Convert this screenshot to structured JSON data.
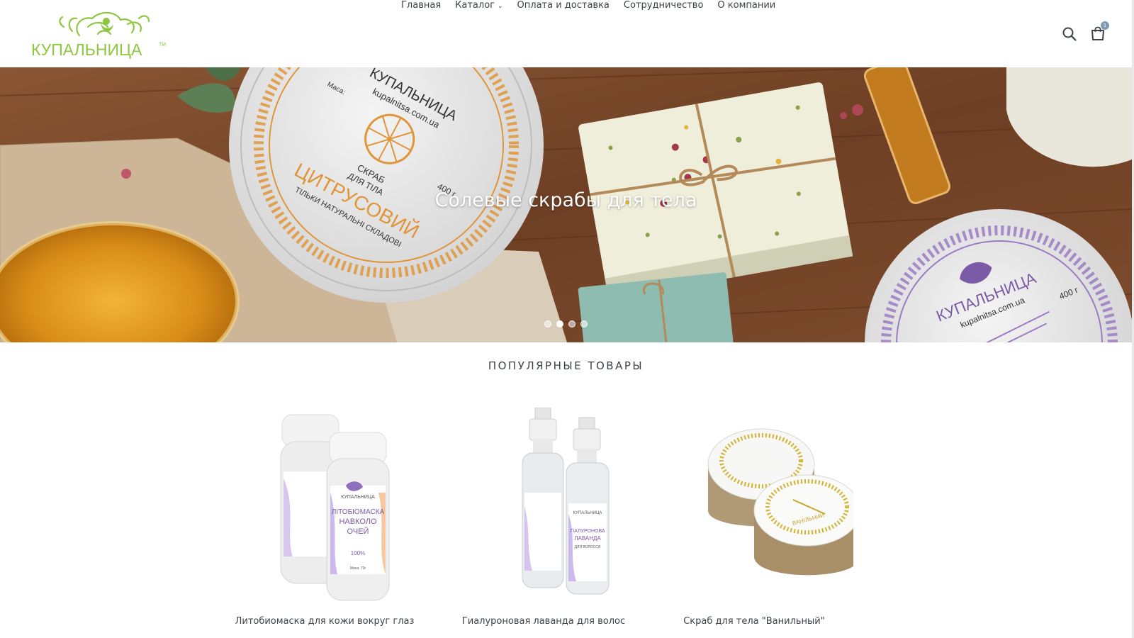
{
  "header": {
    "logo_text": "КУПАЛЬНИЦА",
    "logo_tm": "TM",
    "nav": [
      {
        "label": "Главная"
      },
      {
        "label": "Каталог",
        "has_dropdown": true
      },
      {
        "label": "Оплата и доставка"
      },
      {
        "label": "Сотрудничество"
      },
      {
        "label": "О компании"
      }
    ],
    "cart_count": "1",
    "icons": {
      "search": "search-icon",
      "cart": "cart-icon"
    }
  },
  "hero": {
    "caption": "Солевые скрабы для тела",
    "slides": 4,
    "active_slide": 2,
    "jar1": {
      "brand": "КУПАЛЬНИЦА",
      "site": "kupalnitsa.com.ua",
      "line1": "СКРАБ",
      "line2": "ДЛЯ ТІЛА",
      "name": "ЦИТРУСОВИЙ",
      "tagline": "ТІЛЬКИ НАТУРАЛЬНІ СКЛАДОВІ",
      "weight": "400 г",
      "mass": "Маса:"
    },
    "jar2": {
      "brand": "КУПАЛЬНИЦА",
      "site": "kupalnitsa.com.ua",
      "weight": "400 г"
    }
  },
  "popular": {
    "title": "ПОПУЛЯРНЫЕ ТОВАРЫ",
    "products": [
      {
        "name": "Литобиомаска для кожи вокруг глаз",
        "label_brand": "КУПАЛЬНИЦА",
        "label_title_1": "ЛІТОБІОМАСКА",
        "label_title_2": "НАВКОЛО",
        "label_title_3": "ОЧЕЙ",
        "label_pct": "100%",
        "label_mass": "Маса: 70г"
      },
      {
        "name": "Гиалуроновая лаванда для волос",
        "label_brand": "КУПАЛЬНИЦА",
        "label_title_1": "ГІАЛУРОНОВА",
        "label_title_2": "ЛАВАНДА",
        "label_title_3": "ДЛЯ ВОЛОССЯ"
      },
      {
        "name": "Скраб для тела \"Ванильный\"",
        "label_name": "ВАНІЛЬНИЙ"
      }
    ]
  },
  "colors": {
    "logo_green": "#8dc63f",
    "lavender": "#9b7bc4",
    "orange": "#e0953a",
    "wood": "#7a4a2c",
    "text": "#3d4246"
  }
}
